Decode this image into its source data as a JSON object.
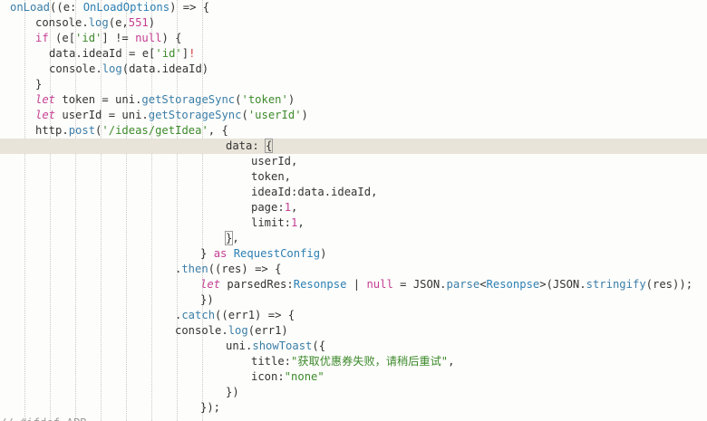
{
  "lines": [
    [
      {
        "t": "onLoad",
        "c": "fn"
      },
      {
        "t": "((e: ",
        "c": "pl"
      },
      {
        "t": "OnLoadOptions",
        "c": "type"
      },
      {
        "t": ") => {",
        "c": "pl"
      }
    ],
    [
      {
        "t": "console",
        "c": "pl"
      },
      {
        "t": ".",
        "c": "pl"
      },
      {
        "t": "log",
        "c": "fn"
      },
      {
        "t": "(e,",
        "c": "pl"
      },
      {
        "t": "551",
        "c": "num"
      },
      {
        "t": ")",
        "c": "pl"
      }
    ],
    [
      {
        "t": "if",
        "c": "kw"
      },
      {
        "t": " (e[",
        "c": "pl"
      },
      {
        "t": "'id'",
        "c": "str"
      },
      {
        "t": "] != ",
        "c": "pl"
      },
      {
        "t": "null",
        "c": "kw"
      },
      {
        "t": ") {",
        "c": "pl"
      }
    ],
    [
      {
        "t": "data.ideaId = e[",
        "c": "pl"
      },
      {
        "t": "'id'",
        "c": "str"
      },
      {
        "t": "]",
        "c": "pl"
      },
      {
        "t": "!",
        "c": "bad"
      }
    ],
    [
      {
        "t": "console",
        "c": "pl"
      },
      {
        "t": ".",
        "c": "pl"
      },
      {
        "t": "log",
        "c": "fn"
      },
      {
        "t": "(data.ideaId)",
        "c": "pl"
      }
    ],
    [
      {
        "t": "}",
        "c": "pl"
      }
    ],
    [
      {
        "t": "let",
        "c": "it"
      },
      {
        "t": " token = uni.",
        "c": "pl"
      },
      {
        "t": "getStorageSync",
        "c": "fn"
      },
      {
        "t": "(",
        "c": "pl"
      },
      {
        "t": "'token'",
        "c": "str"
      },
      {
        "t": ")",
        "c": "pl"
      }
    ],
    [
      {
        "t": "let",
        "c": "it"
      },
      {
        "t": " userId = uni.",
        "c": "pl"
      },
      {
        "t": "getStorageSync",
        "c": "fn"
      },
      {
        "t": "(",
        "c": "pl"
      },
      {
        "t": "'userId'",
        "c": "str"
      },
      {
        "t": ")",
        "c": "pl"
      }
    ],
    [
      {
        "t": "http.",
        "c": "pl"
      },
      {
        "t": "post",
        "c": "fn"
      },
      {
        "t": "(",
        "c": "pl"
      },
      {
        "t": "'/ideas/getIdea'",
        "c": "str"
      },
      {
        "t": ", {",
        "c": "pl"
      }
    ],
    [
      {
        "t": "data: ",
        "c": "pl"
      },
      {
        "t": "{",
        "c": "br"
      }
    ],
    [
      {
        "t": "userId,",
        "c": "pl"
      }
    ],
    [
      {
        "t": "token,",
        "c": "pl"
      }
    ],
    [
      {
        "t": "ideaId:data.ideaId,",
        "c": "pl"
      }
    ],
    [
      {
        "t": "page:",
        "c": "pl"
      },
      {
        "t": "1",
        "c": "num"
      },
      {
        "t": ",",
        "c": "pl"
      }
    ],
    [
      {
        "t": "limit:",
        "c": "pl"
      },
      {
        "t": "1",
        "c": "num"
      },
      {
        "t": ",",
        "c": "pl"
      }
    ],
    [
      {
        "t": "}",
        "c": "br"
      },
      {
        "t": ",",
        "c": "pl"
      }
    ],
    [
      {
        "t": "} ",
        "c": "pl"
      },
      {
        "t": "as",
        "c": "kw"
      },
      {
        "t": " ",
        "c": "pl"
      },
      {
        "t": "RequestConfig",
        "c": "type"
      },
      {
        "t": ")",
        "c": "pl"
      }
    ],
    [
      {
        "t": ".",
        "c": "pl"
      },
      {
        "t": "then",
        "c": "fn"
      },
      {
        "t": "((res) => {",
        "c": "pl"
      }
    ],
    [
      {
        "t": "let",
        "c": "it"
      },
      {
        "t": " parsedRes:",
        "c": "pl"
      },
      {
        "t": "Resonpse",
        "c": "type"
      },
      {
        "t": " | ",
        "c": "pl"
      },
      {
        "t": "null",
        "c": "kw"
      },
      {
        "t": " = JSON.",
        "c": "pl"
      },
      {
        "t": "parse",
        "c": "fn"
      },
      {
        "t": "<",
        "c": "pl"
      },
      {
        "t": "Resonpse",
        "c": "type"
      },
      {
        "t": ">(JSON.",
        "c": "pl"
      },
      {
        "t": "stringify",
        "c": "fn"
      },
      {
        "t": "(res));",
        "c": "pl"
      }
    ],
    [
      {
        "t": "})",
        "c": "pl"
      }
    ],
    [
      {
        "t": ".",
        "c": "pl"
      },
      {
        "t": "catch",
        "c": "fn"
      },
      {
        "t": "((err1) => {",
        "c": "pl"
      }
    ],
    [
      {
        "t": "console",
        "c": "pl"
      },
      {
        "t": ".",
        "c": "pl"
      },
      {
        "t": "log",
        "c": "fn"
      },
      {
        "t": "(err1)",
        "c": "pl"
      }
    ],
    [
      {
        "t": "uni.",
        "c": "pl"
      },
      {
        "t": "showToast",
        "c": "fn"
      },
      {
        "t": "({",
        "c": "pl"
      }
    ],
    [
      {
        "t": "title:",
        "c": "pl"
      },
      {
        "t": "\"获取优惠券失败，请稍后重试\"",
        "c": "str"
      },
      {
        "t": ",",
        "c": "pl"
      }
    ],
    [
      {
        "t": "icon:",
        "c": "pl"
      },
      {
        "t": "\"none\"",
        "c": "str"
      }
    ],
    [
      {
        "t": "})",
        "c": "pl"
      }
    ],
    [
      {
        "t": "});",
        "c": "pl"
      }
    ],
    [
      {
        "t": "// #ifdef APP",
        "c": "cm"
      }
    ]
  ]
}
